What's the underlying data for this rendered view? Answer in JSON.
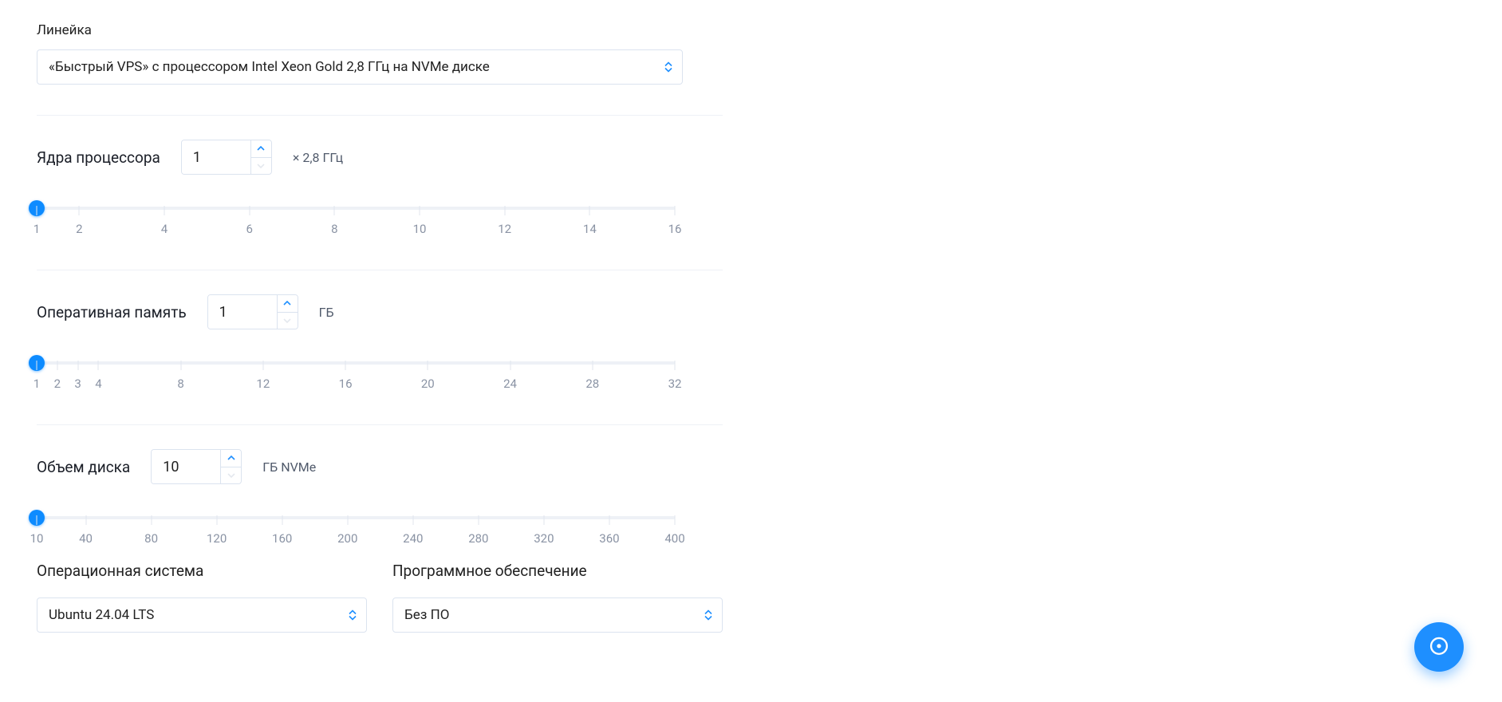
{
  "colors": {
    "accent": "#0d8bff"
  },
  "lineup": {
    "label": "Линейка",
    "seg0": "«Быстрый VPS» с процессором ",
    "seg1": "Intel Xeon Gold 2,8 ГГц",
    "seg2": " на ",
    "seg3": "NVMe",
    "seg4": " диске"
  },
  "cpu": {
    "title": "Ядра процессора",
    "value": "1",
    "unit": "× 2,8 ГГц",
    "min": 1,
    "max": 16,
    "ticks": [
      "1",
      "2",
      "4",
      "6",
      "8",
      "10",
      "12",
      "14",
      "16"
    ]
  },
  "ram": {
    "title": "Оперативная память",
    "value": "1",
    "unit": "ГБ",
    "min": 1,
    "max": 32,
    "ticks": [
      "1",
      "2",
      "3",
      "4",
      "8",
      "12",
      "16",
      "20",
      "24",
      "28",
      "32"
    ]
  },
  "disk": {
    "title": "Объем диска",
    "value": "10",
    "unit": "ГБ NVMe",
    "min": 10,
    "max": 400,
    "ticks": [
      "10",
      "40",
      "80",
      "120",
      "160",
      "200",
      "240",
      "280",
      "320",
      "360",
      "400"
    ]
  },
  "os": {
    "label": "Операционная система",
    "value": "Ubuntu 24.04 LTS"
  },
  "software": {
    "label": "Программное обеспечение",
    "value": "Без ПО"
  }
}
